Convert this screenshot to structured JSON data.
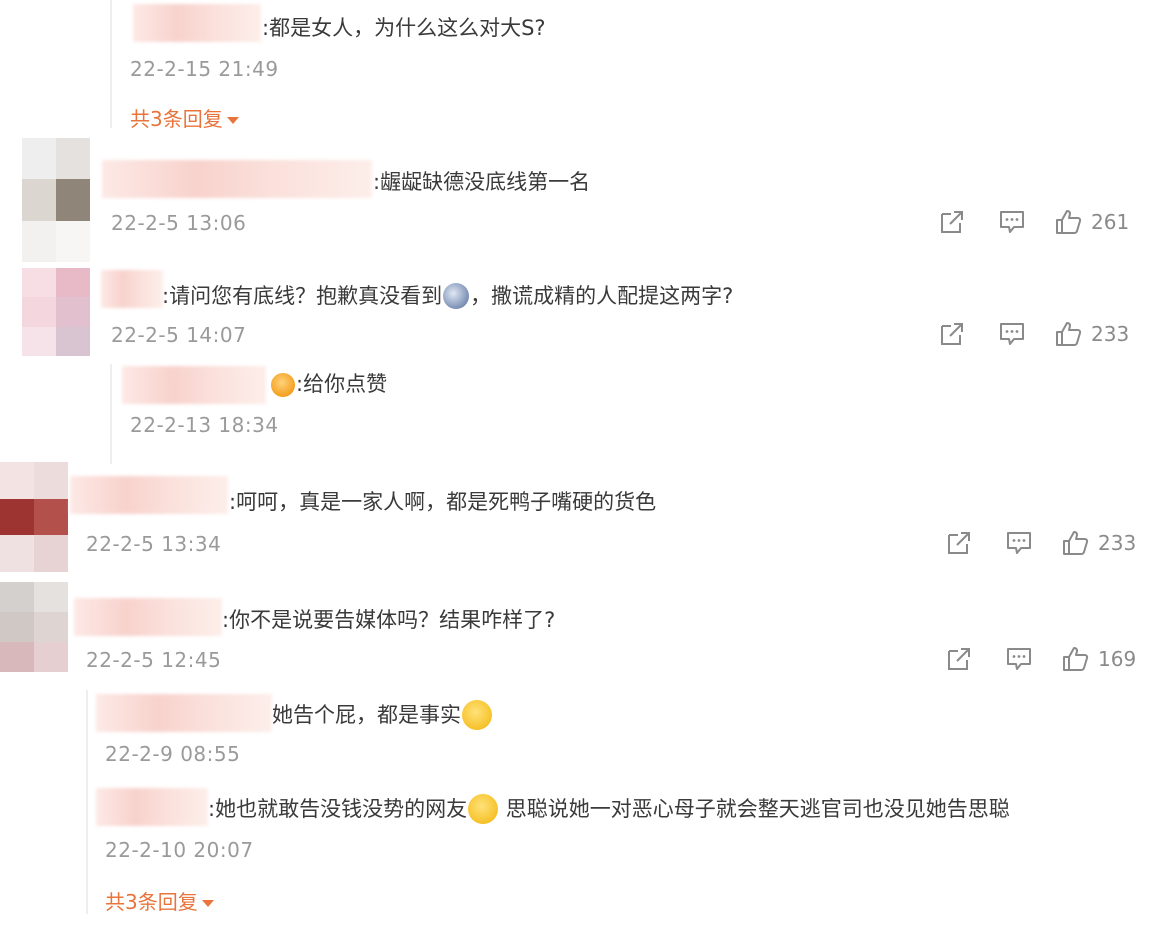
{
  "thread_top": {
    "reply": {
      "text": ":都是女人，为什么这么对大S?",
      "time": "22-2-15 21:49"
    },
    "more_replies": "共3条回复"
  },
  "comments": [
    {
      "text": ":龌龊缺德没底线第一名",
      "time": "22-2-5 13:06",
      "likes": "261"
    },
    {
      "text_before_emoji": ":请问您有底线？抱歉真没看到",
      "emoji": "sad-emoji",
      "text_after_emoji": "，撒谎成精的人配提这两字?",
      "time": "22-2-5 14:07",
      "likes": "233"
    },
    {
      "text": ":呵呵，真是一家人啊，都是死鸭子嘴硬的货色",
      "time": "22-2-5 13:34",
      "likes": "233"
    },
    {
      "text": ":你不是说要告媒体吗？结果咋样了?",
      "time": "22-2-5 12:45",
      "likes": "169"
    }
  ],
  "reply_to_comment_2": {
    "emoji": "heart-eyes-emoji",
    "text": ":给你点赞",
    "time": "22-2-13 18:34"
  },
  "replies_to_comment_4": [
    {
      "text": "她告个屁，都是事实",
      "emoji": "laugh-cry-emoji",
      "time": "22-2-9 08:55"
    },
    {
      "text_before_emoji": ":她也就敢告没钱没势的网友",
      "emoji": "grin-emoji",
      "text_after_emoji": " 思聪说她一对恶心母子就会整天逃官司也没见她告思聪",
      "time": "22-2-10 20:07"
    }
  ],
  "more_replies_bottom": "共3条回复",
  "icons": {
    "share": "share-icon",
    "comment": "comment-icon",
    "like": "thumbs-up-icon"
  },
  "colors": {
    "accent": "#e8743b",
    "time": "#9a9a9a",
    "icon": "#8a8a8a"
  }
}
